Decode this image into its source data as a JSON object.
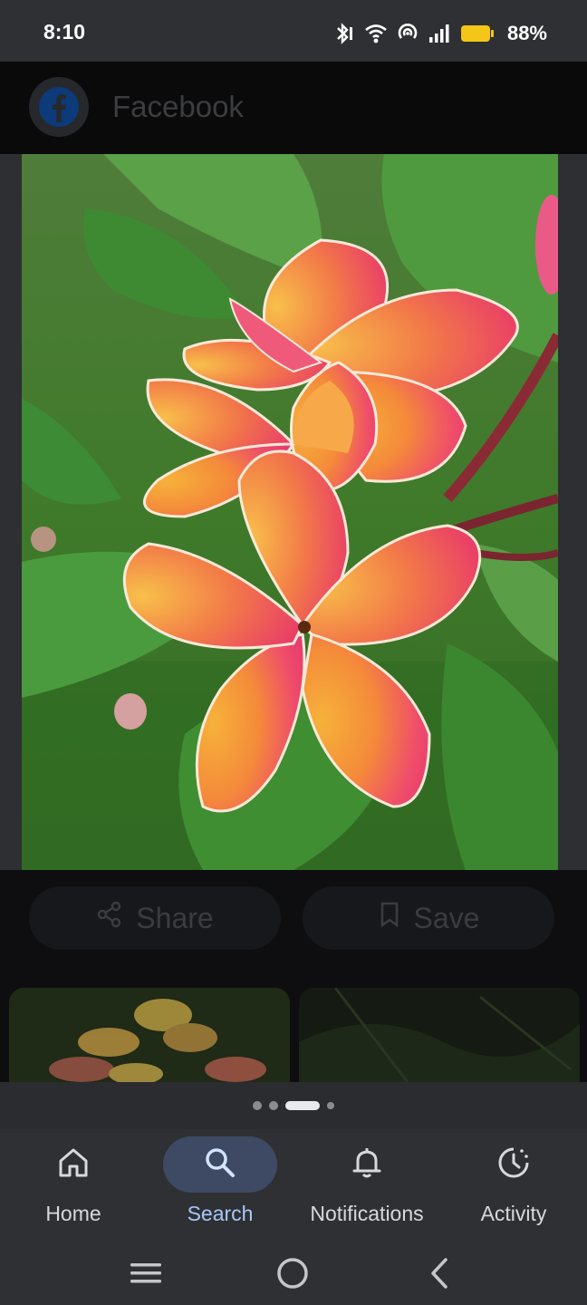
{
  "status_bar": {
    "time": "8:10",
    "battery": "88%"
  },
  "header": {
    "source_title": "Facebook"
  },
  "actions": {
    "share_label": "Share",
    "save_label": "Save"
  },
  "pager": {
    "count": 4,
    "active_index": 2
  },
  "bottom_nav": {
    "items": [
      {
        "label": "Home",
        "icon": "home-icon",
        "selected": false
      },
      {
        "label": "Search",
        "icon": "search-icon",
        "selected": true
      },
      {
        "label": "Notifications",
        "icon": "bell-icon",
        "selected": false
      },
      {
        "label": "Activity",
        "icon": "history-icon",
        "selected": false
      }
    ]
  },
  "colors": {
    "accent": "#a8c7fa",
    "selected_pill": "#3e4a63",
    "bar_bg": "#2f3033"
  }
}
